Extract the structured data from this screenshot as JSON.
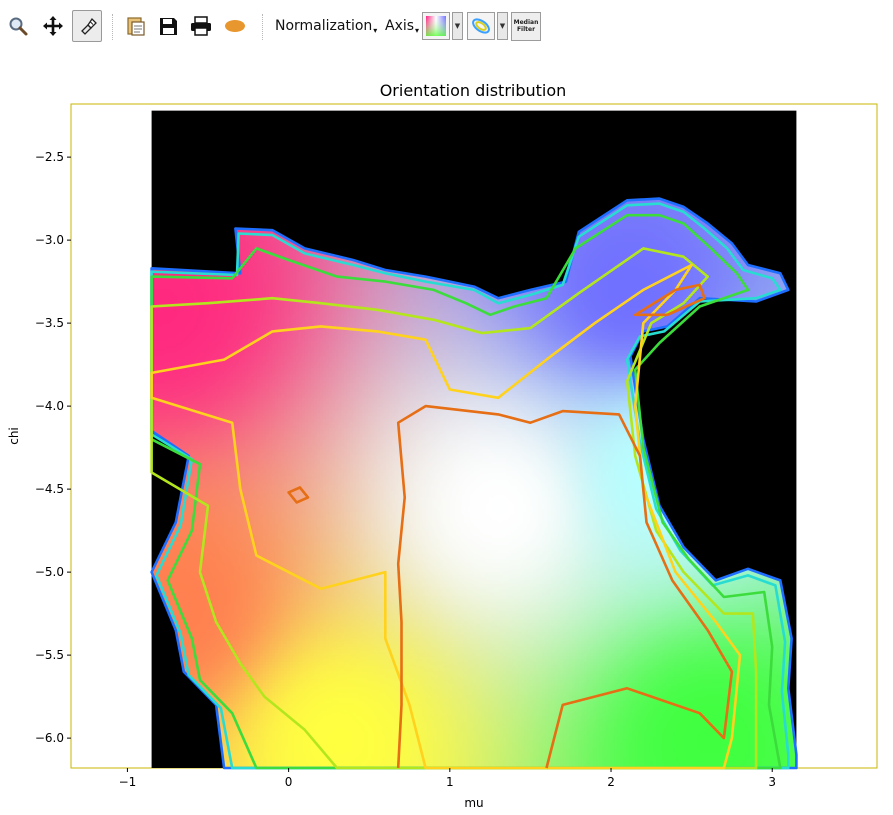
{
  "toolbar": {
    "normalization_label": "Normalization",
    "axis_label": "Axis",
    "median_filter_label_line1": "Median",
    "median_filter_label_line2": "Filter"
  },
  "colors": {
    "pole_region_bg": "#000000",
    "plot_frame": "#c8b400"
  },
  "chart_data": {
    "type": "heatmap",
    "title": "Orientation distribution",
    "xlabel": "mu",
    "ylabel": "chi",
    "xlim": [
      -1.35,
      3.65
    ],
    "ylim": [
      -6.18,
      -2.18
    ],
    "x_ticks": [
      -1,
      0,
      1,
      2,
      3
    ],
    "y_ticks": [
      -2.5,
      -3.0,
      -3.5,
      -4.0,
      -4.5,
      -5.0,
      -5.5,
      -6.0
    ],
    "x_tick_labels": [
      "−1",
      "0",
      "1",
      "2",
      "3"
    ],
    "y_tick_labels": [
      "−2.5",
      "−3.0",
      "−3.5",
      "−4.0",
      "−4.5",
      "−5.0",
      "−5.5",
      "−6.0"
    ],
    "data_extent": {
      "mu": [
        -0.85,
        3.15
      ],
      "chi": [
        -6.18,
        -2.22
      ]
    },
    "color_anchors": [
      {
        "mu": -0.8,
        "chi": -3.4,
        "color": "#ff2a80"
      },
      {
        "mu": 2.1,
        "chi": -3.3,
        "color": "#7070ff"
      },
      {
        "mu": 1.3,
        "chi": -4.6,
        "color": "#ffffff"
      },
      {
        "mu": 2.3,
        "chi": -4.4,
        "color": "#b8ffff"
      },
      {
        "mu": 0.3,
        "chi": -6.0,
        "color": "#ffff40"
      },
      {
        "mu": 2.6,
        "chi": -6.0,
        "color": "#40ff40"
      },
      {
        "mu": -0.7,
        "chi": -5.2,
        "color": "#ff8050"
      }
    ],
    "contours": [
      {
        "level_color": "#1e6eff",
        "points": [
          [
            -0.85,
            -3.17
          ],
          [
            -0.3,
            -3.2
          ],
          [
            -0.33,
            -2.93
          ],
          [
            -0.1,
            -2.94
          ],
          [
            0.1,
            -3.05
          ],
          [
            0.4,
            -3.12
          ],
          [
            0.6,
            -3.18
          ],
          [
            0.85,
            -3.22
          ],
          [
            1.15,
            -3.28
          ],
          [
            1.3,
            -3.35
          ],
          [
            1.5,
            -3.3
          ],
          [
            1.72,
            -3.25
          ],
          [
            1.8,
            -2.95
          ],
          [
            2.1,
            -2.76
          ],
          [
            2.3,
            -2.75
          ],
          [
            2.45,
            -2.8
          ],
          [
            2.6,
            -2.9
          ],
          [
            2.75,
            -3.02
          ],
          [
            2.85,
            -3.15
          ],
          [
            3.05,
            -3.2
          ],
          [
            3.1,
            -3.3
          ],
          [
            2.9,
            -3.37
          ],
          [
            2.55,
            -3.35
          ],
          [
            2.35,
            -3.52
          ],
          [
            2.2,
            -3.55
          ],
          [
            2.12,
            -3.7
          ],
          [
            2.2,
            -4.2
          ],
          [
            2.3,
            -4.6
          ],
          [
            2.45,
            -4.85
          ],
          [
            2.65,
            -5.05
          ],
          [
            2.85,
            -4.98
          ],
          [
            3.05,
            -5.05
          ],
          [
            3.12,
            -5.4
          ],
          [
            3.1,
            -5.7
          ],
          [
            3.15,
            -6.1
          ],
          [
            3.15,
            -6.18
          ],
          [
            -0.4,
            -6.18
          ],
          [
            -0.45,
            -5.8
          ],
          [
            -0.65,
            -5.6
          ],
          [
            -0.7,
            -5.35
          ],
          [
            -0.85,
            -5.0
          ],
          [
            -0.7,
            -4.7
          ],
          [
            -0.62,
            -4.3
          ],
          [
            -0.85,
            -4.15
          ]
        ]
      },
      {
        "level_color": "#28dcd2",
        "points": [
          [
            -0.85,
            -3.19
          ],
          [
            -0.32,
            -3.21
          ],
          [
            -0.31,
            -2.96
          ],
          [
            -0.1,
            -2.97
          ],
          [
            0.1,
            -3.08
          ],
          [
            0.4,
            -3.15
          ],
          [
            0.6,
            -3.2
          ],
          [
            0.85,
            -3.25
          ],
          [
            1.15,
            -3.3
          ],
          [
            1.3,
            -3.38
          ],
          [
            1.5,
            -3.33
          ],
          [
            1.7,
            -3.27
          ],
          [
            1.8,
            -2.98
          ],
          [
            2.1,
            -2.79
          ],
          [
            2.3,
            -2.78
          ],
          [
            2.45,
            -2.83
          ],
          [
            2.58,
            -2.93
          ],
          [
            2.72,
            -3.05
          ],
          [
            2.82,
            -3.18
          ],
          [
            3.0,
            -3.23
          ],
          [
            3.05,
            -3.3
          ],
          [
            2.9,
            -3.35
          ],
          [
            2.55,
            -3.37
          ],
          [
            2.33,
            -3.55
          ],
          [
            2.18,
            -3.58
          ],
          [
            2.1,
            -3.72
          ],
          [
            2.18,
            -4.22
          ],
          [
            2.28,
            -4.62
          ],
          [
            2.43,
            -4.87
          ],
          [
            2.63,
            -5.08
          ],
          [
            2.85,
            -5.02
          ],
          [
            3.02,
            -5.08
          ],
          [
            3.08,
            -5.42
          ],
          [
            3.06,
            -5.72
          ],
          [
            3.1,
            -6.1
          ],
          [
            3.1,
            -6.18
          ],
          [
            -0.35,
            -6.18
          ],
          [
            -0.42,
            -5.82
          ],
          [
            -0.62,
            -5.62
          ],
          [
            -0.67,
            -5.37
          ],
          [
            -0.82,
            -5.02
          ],
          [
            -0.67,
            -4.72
          ],
          [
            -0.6,
            -4.32
          ],
          [
            -0.85,
            -4.17
          ]
        ]
      },
      {
        "level_color": "#3cdc3c",
        "points": [
          [
            -0.85,
            -3.22
          ],
          [
            -0.35,
            -3.23
          ],
          [
            -0.2,
            -3.05
          ],
          [
            0.0,
            -3.12
          ],
          [
            0.3,
            -3.22
          ],
          [
            0.6,
            -3.25
          ],
          [
            0.9,
            -3.3
          ],
          [
            1.1,
            -3.38
          ],
          [
            1.25,
            -3.45
          ],
          [
            1.4,
            -3.4
          ],
          [
            1.6,
            -3.35
          ],
          [
            1.78,
            -3.05
          ],
          [
            2.1,
            -2.85
          ],
          [
            2.3,
            -2.85
          ],
          [
            2.45,
            -2.9
          ],
          [
            2.62,
            -3.05
          ],
          [
            2.78,
            -3.2
          ],
          [
            2.85,
            -3.3
          ],
          [
            2.55,
            -3.4
          ],
          [
            2.3,
            -3.62
          ],
          [
            2.15,
            -3.78
          ],
          [
            2.2,
            -4.25
          ],
          [
            2.32,
            -4.7
          ],
          [
            2.48,
            -4.92
          ],
          [
            2.7,
            -5.15
          ],
          [
            2.95,
            -5.12
          ],
          [
            3.0,
            -5.45
          ],
          [
            2.98,
            -5.8
          ],
          [
            3.05,
            -6.18
          ],
          [
            -0.2,
            -6.18
          ],
          [
            -0.35,
            -5.85
          ],
          [
            -0.55,
            -5.65
          ],
          [
            -0.6,
            -5.4
          ],
          [
            -0.75,
            -5.05
          ],
          [
            -0.6,
            -4.75
          ],
          [
            -0.55,
            -4.35
          ],
          [
            -0.85,
            -4.2
          ]
        ]
      },
      {
        "level_color": "#b4e61e",
        "points": [
          [
            -0.85,
            -3.4
          ],
          [
            -0.5,
            -3.38
          ],
          [
            -0.1,
            -3.35
          ],
          [
            0.2,
            -3.38
          ],
          [
            0.55,
            -3.42
          ],
          [
            0.9,
            -3.48
          ],
          [
            1.2,
            -3.56
          ],
          [
            1.5,
            -3.53
          ],
          [
            1.8,
            -3.32
          ],
          [
            2.2,
            -3.05
          ],
          [
            2.45,
            -3.1
          ],
          [
            2.6,
            -3.22
          ],
          [
            2.45,
            -3.38
          ],
          [
            2.25,
            -3.5
          ],
          [
            2.1,
            -3.85
          ],
          [
            2.15,
            -4.3
          ],
          [
            2.28,
            -4.75
          ],
          [
            2.45,
            -5.0
          ],
          [
            2.7,
            -5.25
          ],
          [
            2.88,
            -5.25
          ],
          [
            2.9,
            -5.6
          ],
          [
            2.9,
            -6.18
          ],
          [
            0.3,
            -6.18
          ],
          [
            0.1,
            -5.95
          ],
          [
            -0.15,
            -5.75
          ],
          [
            -0.3,
            -5.55
          ],
          [
            -0.45,
            -5.3
          ],
          [
            -0.55,
            -5.0
          ],
          [
            -0.5,
            -4.6
          ],
          [
            -0.85,
            -4.4
          ]
        ]
      },
      {
        "level_color": "#ffd21e",
        "points": [
          [
            -0.85,
            -3.8
          ],
          [
            -0.4,
            -3.72
          ],
          [
            -0.1,
            -3.55
          ],
          [
            0.2,
            -3.52
          ],
          [
            0.55,
            -3.55
          ],
          [
            0.85,
            -3.6
          ],
          [
            1.0,
            -3.9
          ],
          [
            1.3,
            -3.95
          ],
          [
            1.6,
            -3.72
          ],
          [
            1.9,
            -3.5
          ],
          [
            2.2,
            -3.3
          ],
          [
            2.5,
            -3.15
          ],
          [
            2.4,
            -3.3
          ],
          [
            2.2,
            -3.5
          ],
          [
            2.15,
            -4.0
          ],
          [
            2.2,
            -4.5
          ],
          [
            2.4,
            -5.0
          ],
          [
            2.65,
            -5.3
          ],
          [
            2.8,
            -5.5
          ],
          [
            2.75,
            -6.0
          ],
          [
            2.7,
            -6.18
          ],
          [
            0.85,
            -6.18
          ],
          [
            0.75,
            -5.8
          ],
          [
            0.6,
            -5.4
          ],
          [
            0.6,
            -5.0
          ],
          [
            0.2,
            -5.1
          ],
          [
            -0.2,
            -4.9
          ],
          [
            -0.3,
            -4.5
          ],
          [
            -0.35,
            -4.1
          ],
          [
            -0.85,
            -3.95
          ]
        ]
      },
      {
        "level_color": "#e66e14",
        "points": [
          [
            0.68,
            -6.18
          ],
          [
            0.7,
            -5.8
          ],
          [
            0.7,
            -5.3
          ],
          [
            0.68,
            -4.95
          ],
          [
            0.72,
            -4.55
          ],
          [
            0.68,
            -4.1
          ],
          [
            0.85,
            -4.0
          ],
          [
            1.3,
            -4.05
          ],
          [
            1.5,
            -4.1
          ],
          [
            1.7,
            -4.03
          ],
          [
            2.05,
            -4.05
          ],
          [
            2.18,
            -4.3
          ],
          [
            2.22,
            -4.7
          ],
          [
            2.38,
            -5.05
          ],
          [
            2.6,
            -5.35
          ],
          [
            2.75,
            -5.6
          ],
          [
            2.7,
            -6.0
          ],
          [
            2.55,
            -5.85
          ],
          [
            2.1,
            -5.7
          ],
          [
            1.7,
            -5.8
          ],
          [
            1.6,
            -6.18
          ]
        ]
      },
      {
        "level_color": "#e66e14",
        "points": [
          [
            2.15,
            -3.45
          ],
          [
            2.4,
            -3.3
          ],
          [
            2.55,
            -3.27
          ],
          [
            2.58,
            -3.35
          ],
          [
            2.35,
            -3.45
          ]
        ]
      },
      {
        "level_color": "#e66e14",
        "points": [
          [
            0.0,
            -4.52
          ],
          [
            0.07,
            -4.49
          ],
          [
            0.12,
            -4.55
          ],
          [
            0.05,
            -4.58
          ]
        ]
      }
    ]
  }
}
